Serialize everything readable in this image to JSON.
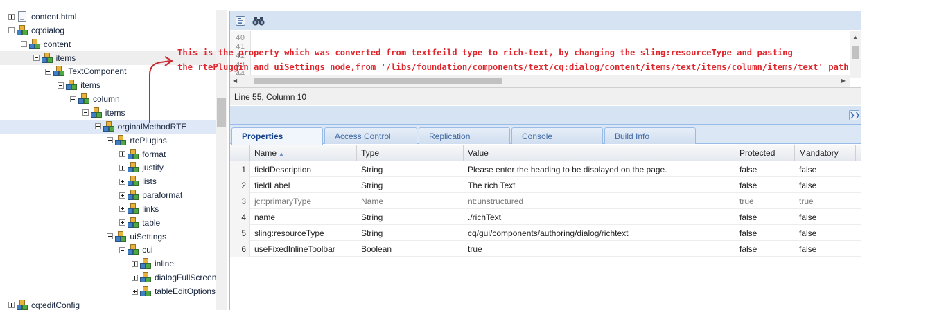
{
  "tree": {
    "nodes": [
      {
        "label": "content.html",
        "depth": 0,
        "toggle": "plus",
        "icon": "file-icon",
        "state": ""
      },
      {
        "label": "cq:dialog",
        "depth": 0,
        "toggle": "minus",
        "icon": "node-cubes-icon",
        "state": ""
      },
      {
        "label": "content",
        "depth": 1,
        "toggle": "minus",
        "icon": "node-cubes-icon",
        "state": ""
      },
      {
        "label": "items",
        "depth": 2,
        "toggle": "minus",
        "icon": "node-cubes-icon",
        "state": "hover"
      },
      {
        "label": "TextComponent",
        "depth": 3,
        "toggle": "minus",
        "icon": "node-cubes-icon",
        "state": ""
      },
      {
        "label": "items",
        "depth": 4,
        "toggle": "minus",
        "icon": "node-cubes-icon",
        "state": ""
      },
      {
        "label": "column",
        "depth": 5,
        "toggle": "minus",
        "icon": "node-cubes-icon",
        "state": ""
      },
      {
        "label": "items",
        "depth": 6,
        "toggle": "minus",
        "icon": "node-cubes-icon",
        "state": ""
      },
      {
        "label": "orginalMethodRTE",
        "depth": 7,
        "toggle": "minus",
        "icon": "node-cubes-icon",
        "state": "selected"
      },
      {
        "label": "rtePlugins",
        "depth": 8,
        "toggle": "minus",
        "icon": "node-cubes-icon",
        "state": ""
      },
      {
        "label": "format",
        "depth": 9,
        "toggle": "plus",
        "icon": "node-cubes-icon",
        "state": ""
      },
      {
        "label": "justify",
        "depth": 9,
        "toggle": "plus",
        "icon": "node-cubes-icon",
        "state": ""
      },
      {
        "label": "lists",
        "depth": 9,
        "toggle": "plus",
        "icon": "node-cubes-icon",
        "state": ""
      },
      {
        "label": "paraformat",
        "depth": 9,
        "toggle": "plus",
        "icon": "node-cubes-icon",
        "state": ""
      },
      {
        "label": "links",
        "depth": 9,
        "toggle": "plus",
        "icon": "node-cubes-icon",
        "state": ""
      },
      {
        "label": "table",
        "depth": 9,
        "toggle": "plus",
        "icon": "node-cubes-icon",
        "state": ""
      },
      {
        "label": "uiSettings",
        "depth": 8,
        "toggle": "minus",
        "icon": "node-cubes-icon",
        "state": ""
      },
      {
        "label": "cui",
        "depth": 9,
        "toggle": "minus",
        "icon": "node-cubes-icon",
        "state": ""
      },
      {
        "label": "inline",
        "depth": 10,
        "toggle": "plus",
        "icon": "node-cubes-icon",
        "state": ""
      },
      {
        "label": "dialogFullScreen",
        "depth": 10,
        "toggle": "plus",
        "icon": "node-cubes-icon",
        "state": ""
      },
      {
        "label": "tableEditOptions",
        "depth": 10,
        "toggle": "plus",
        "icon": "node-cubes-icon",
        "state": ""
      },
      {
        "label": "cq:editConfig",
        "depth": 0,
        "toggle": "plus",
        "icon": "node-cubes-icon",
        "state": ""
      }
    ]
  },
  "editor": {
    "line_numbers": [
      "40",
      "41",
      "42",
      "43",
      "44"
    ],
    "status": "Line 55, Column 10"
  },
  "tabs": [
    "Properties",
    "Access Control",
    "Replication",
    "Console",
    "Build Info"
  ],
  "active_tab": "Properties",
  "grid": {
    "columns": [
      "Name",
      "Type",
      "Value",
      "Protected",
      "Mandatory"
    ],
    "sorted_column": "Name",
    "rows": [
      {
        "num": "1",
        "name": "fieldDescription",
        "type": "String",
        "value": "Please enter the heading to be displayed on the page.",
        "protected": "false",
        "mandatory": "false",
        "muted": false
      },
      {
        "num": "2",
        "name": "fieldLabel",
        "type": "String",
        "value": "The rich Text",
        "protected": "false",
        "mandatory": "false",
        "muted": false
      },
      {
        "num": "3",
        "name": "jcr:primaryType",
        "type": "Name",
        "value": "nt:unstructured",
        "protected": "true",
        "mandatory": "true",
        "muted": true
      },
      {
        "num": "4",
        "name": "name",
        "type": "String",
        "value": "./richText",
        "protected": "false",
        "mandatory": "false",
        "muted": false
      },
      {
        "num": "5",
        "name": "sling:resourceType",
        "type": "String",
        "value": "cq/gui/components/authoring/dialog/richtext",
        "protected": "false",
        "mandatory": "false",
        "muted": false
      },
      {
        "num": "6",
        "name": "useFixedInlineToolbar",
        "type": "Boolean",
        "value": "true",
        "protected": "false",
        "mandatory": "false",
        "muted": false
      }
    ]
  },
  "annotation": {
    "line1": "This is the property which was converted from textfeild type to rich-text, by changing the sling:resourceType and pasting",
    "line2": "the rtePluggin and uiSettings node,from '/libs/foundation/components/text/cq:dialog/content/items/text/items/column/items/text' path",
    "color": "#e0262d"
  },
  "colors": {
    "panel_header": "#d6e3f2",
    "border": "#99bbe8",
    "selected_row": "#dfe8f6",
    "tab_active_text": "#15428b"
  }
}
